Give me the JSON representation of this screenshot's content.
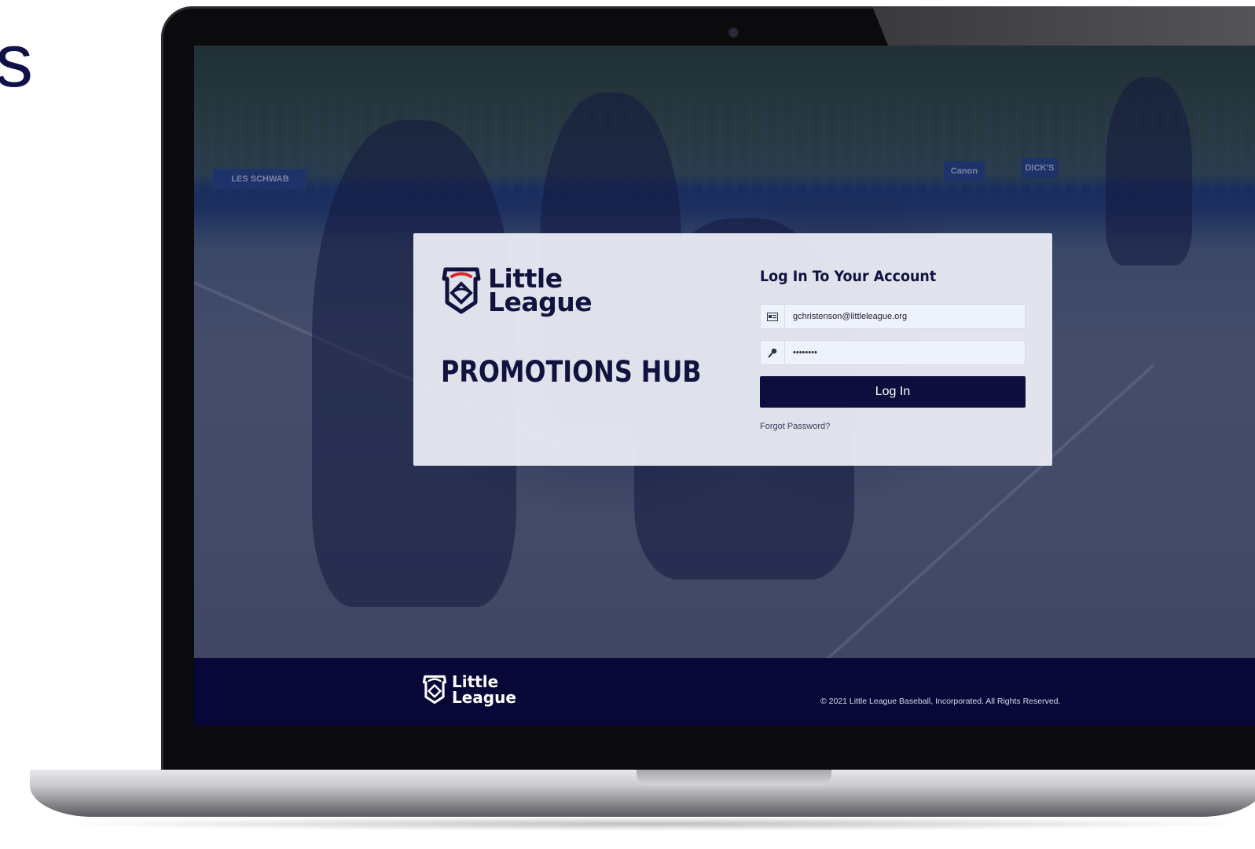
{
  "slide": {
    "partial_heading": "s"
  },
  "brand": {
    "name_line1": "Little",
    "name_line2": "League"
  },
  "hub_title": "PROMOTIONS HUB",
  "login": {
    "title": "Log In To Your Account",
    "email_value": "gchristenson@littleleague.org",
    "password_value": "••••••••",
    "email_icon": "id-card-icon",
    "password_icon": "key-icon",
    "submit_label": "Log In",
    "forgot_label": "Forgot Password?"
  },
  "footer": {
    "brand_line1": "Little",
    "brand_line2": "League",
    "copyright": "© 2021 Little League Baseball, Incorporated. All Rights Reserved."
  },
  "background_banners": [
    "LES SCHWAB",
    "Canon",
    "DICK'S"
  ],
  "colors": {
    "navy": "#0d0e3d",
    "card": "#eef0f7",
    "footer": "#070838",
    "accent_red": "#d9262c"
  }
}
